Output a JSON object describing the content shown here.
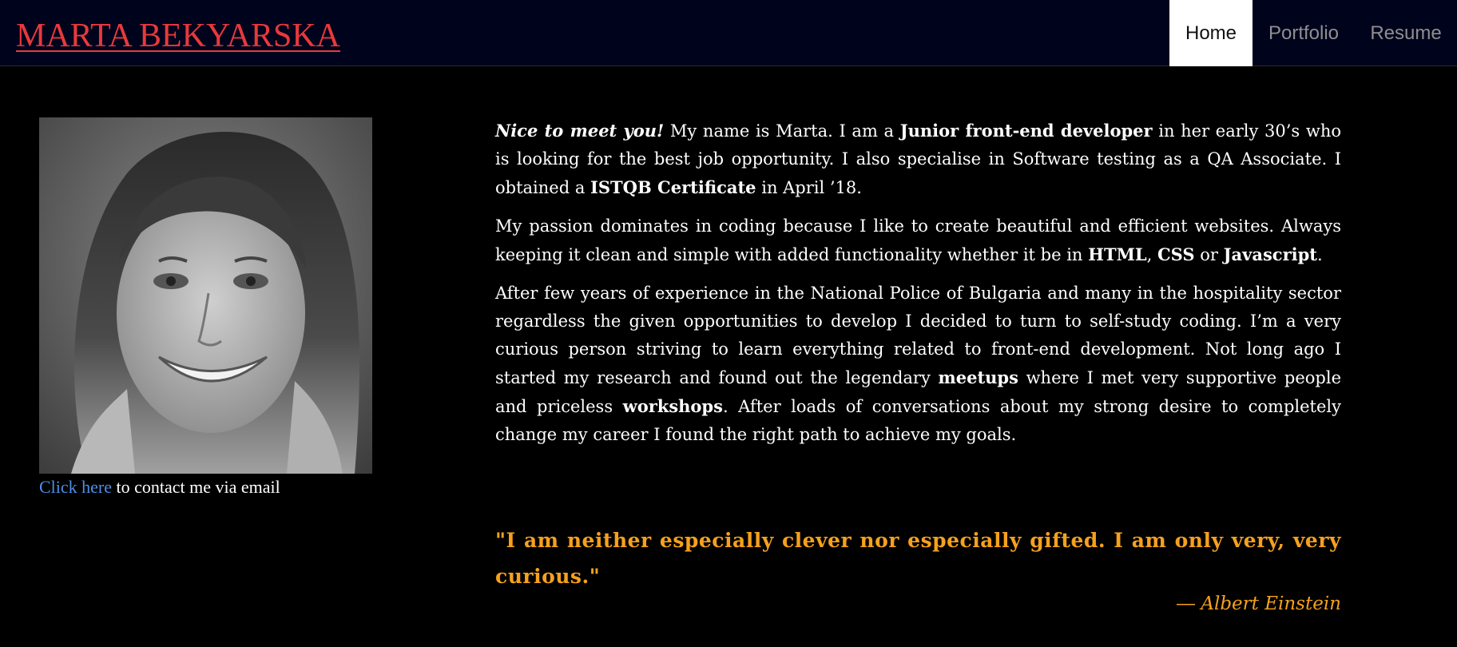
{
  "header": {
    "brand": "MARTA BEKYARSKA",
    "nav": [
      {
        "label": "Home",
        "active": true
      },
      {
        "label": "Portfolio",
        "active": false
      },
      {
        "label": "Resume",
        "active": false
      }
    ]
  },
  "contact": {
    "link_text": "Click here",
    "rest_text": " to contact me via email"
  },
  "bio": {
    "p1": {
      "intro": "Nice to meet you!",
      "t1": " My name is Marta. I am a ",
      "role": "Junior front-end developer",
      "t2": " in her early 30’s who is looking for the best job opportunity. I also specialise in Software testing as a QA Associate. I obtained a ",
      "cert": "ISTQB Certificate",
      "t3": " in April ’18."
    },
    "p2": {
      "t1": "My passion dominates in coding because I like to create beautiful and efficient websites. Always keeping it clean and simple with added functionality whether it be in ",
      "html": "HTML",
      "sep1": ", ",
      "css": "CSS",
      "sep2": " or ",
      "js": "Javascript",
      "end": "."
    },
    "p3": {
      "t1": "After few years of experience in the National Police of Bulgaria and many in the hospitality sector regardless the given opportunities to develop I decided to turn to self-study coding. I’m a very curious person striving to learn everything related to front-end development. Not long ago I started my research and found out the legendary ",
      "meetups": "meetups",
      "t2": " where I met very supportive people and priceless ",
      "workshops": "workshops",
      "t3": ". After loads of conversations about my strong desire to completely change my career I found the right path to achieve my goals."
    }
  },
  "quote": {
    "text": "\"I am neither especially clever nor especially gifted. I am only very, very curious.\"",
    "author": "― Albert Einstein"
  },
  "colors": {
    "nav_bg": "#00031c",
    "brand": "#e8393c",
    "link": "#4d8fe6",
    "quote": "#f5a11d"
  }
}
